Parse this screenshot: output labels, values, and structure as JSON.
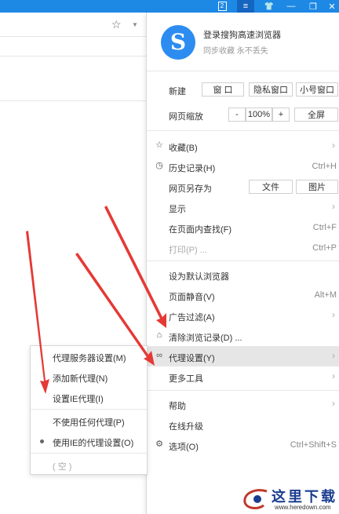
{
  "titlebar": {
    "badge": "2",
    "menu_glyph": "≡",
    "skin_glyph": "👕",
    "min_glyph": "—",
    "restore_glyph": "❐",
    "close_glyph": "✕"
  },
  "browser": {
    "star_glyph": "☆",
    "caret_glyph": "▼"
  },
  "login": {
    "logo_letter": "S",
    "title": "登录搜狗高速浏览器",
    "subtitle": "同步收藏 永不丢失"
  },
  "new_row": {
    "label": "新建",
    "window": "窗 口",
    "private": "隐私窗口",
    "small": "小号窗口"
  },
  "zoom_row": {
    "label": "网页缩放",
    "minus": "-",
    "value": "100%",
    "plus": "+",
    "fullscreen": "全屏"
  },
  "items": {
    "favorites": {
      "label": "收藏(B)"
    },
    "history": {
      "label": "历史记录(H)",
      "shortcut": "Ctrl+H"
    },
    "saveas": {
      "label": "网页另存为",
      "file": "文件",
      "image": "图片"
    },
    "display": {
      "label": "显示"
    },
    "find": {
      "label": "在页面内查找(F)",
      "shortcut": "Ctrl+F"
    },
    "print": {
      "label": "打印(P) ...",
      "shortcut": "Ctrl+P"
    },
    "default": {
      "label": "设为默认浏览器"
    },
    "mute": {
      "label": "页面静音(V)",
      "shortcut": "Alt+M"
    },
    "adfilter": {
      "label": "广告过滤(A)"
    },
    "clear": {
      "label": "清除浏览记录(D) ..."
    },
    "proxy": {
      "label": "代理设置(Y)"
    },
    "tools": {
      "label": "更多工具"
    },
    "help": {
      "label": "帮助"
    },
    "upgrade": {
      "label": "在线升级"
    },
    "options": {
      "label": "选项(O)",
      "shortcut": "Ctrl+Shift+S"
    }
  },
  "submenu": {
    "server": "代理服务器设置(M)",
    "add": "添加新代理(N)",
    "ie": "设置IE代理(I)",
    "none": "不使用任何代理(P)",
    "use_ie": "使用IE的代理设置(O)",
    "empty": "( 空 )"
  },
  "watermark": {
    "text": "这里下载",
    "url": "www.heredown.com"
  },
  "colors": {
    "titlebar": "#1e88e5",
    "logo": "#2d8cf0",
    "arrow": "#e53935",
    "highlight": "#e6e6e6"
  }
}
